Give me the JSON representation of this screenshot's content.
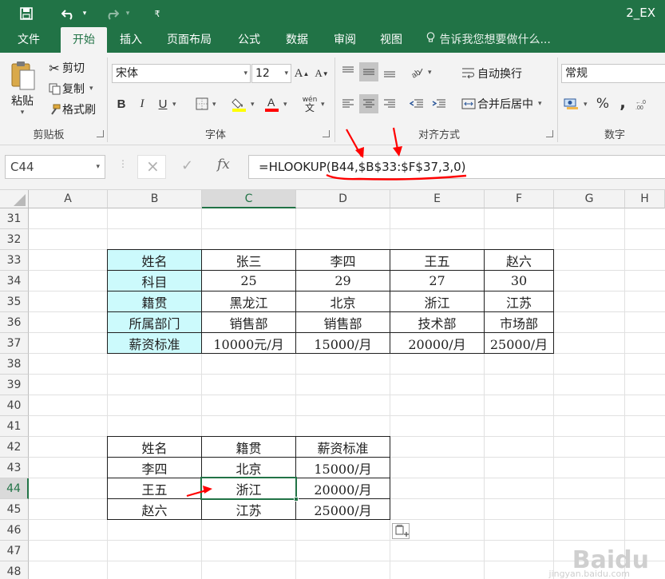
{
  "titlebar": {
    "doc_title": "2_EX",
    "save_icon": "save-icon",
    "undo_icon": "undo-icon",
    "redo_icon": "redo-icon",
    "customize_icon": "customize-qat-icon"
  },
  "tabs": {
    "file": "文件",
    "home": "开始",
    "insert": "插入",
    "layout": "页面布局",
    "formulas": "公式",
    "data": "数据",
    "review": "审阅",
    "view": "视图",
    "tell_me": "告诉我您想要做什么..."
  },
  "ribbon": {
    "clipboard": {
      "paste": "粘贴",
      "cut": "剪切",
      "copy": "复制",
      "format_painter": "格式刷",
      "label": "剪贴板"
    },
    "font": {
      "name": "宋体",
      "size": "12",
      "bold": "B",
      "italic": "I",
      "underline": "U",
      "phonetic": "wén",
      "label": "字体"
    },
    "alignment": {
      "wrap_text": "自动换行",
      "merge_center": "合并后居中",
      "label": "对齐方式"
    },
    "number": {
      "format": "常规",
      "percent": "%",
      "comma": ",",
      "label": "数字"
    }
  },
  "formula_bar": {
    "name_box": "C44",
    "cancel": "×",
    "enter": "✓",
    "fx": "fx",
    "formula": "=HLOOKUP(B44,$B$33:$F$37,3,0)"
  },
  "grid": {
    "columns": [
      "A",
      "B",
      "C",
      "D",
      "E",
      "F",
      "G",
      "H"
    ],
    "rows": [
      "31",
      "32",
      "33",
      "34",
      "35",
      "36",
      "37",
      "38",
      "39",
      "40",
      "41",
      "42",
      "43",
      "44",
      "45",
      "46",
      "47",
      "48"
    ],
    "active_column": "C",
    "active_row": "44",
    "table1": [
      [
        "姓名",
        "张三",
        "李四",
        "王五",
        "赵六"
      ],
      [
        "科目",
        "25",
        "29",
        "27",
        "30"
      ],
      [
        "籍贯",
        "黑龙江",
        "北京",
        "浙江",
        "江苏"
      ],
      [
        "所属部门",
        "销售部",
        "销售部",
        "技术部",
        "市场部"
      ],
      [
        "薪资标准",
        "10000元/月",
        "15000/月",
        "20000/月",
        "25000/月"
      ]
    ],
    "table2": [
      [
        "姓名",
        "籍贯",
        "薪资标准"
      ],
      [
        "李四",
        "北京",
        "15000/月"
      ],
      [
        "王五",
        "浙江",
        "20000/月"
      ],
      [
        "赵六",
        "江苏",
        "25000/月"
      ]
    ]
  },
  "watermark": {
    "brand": "Baidu",
    "url": "jingyan.baidu.com"
  },
  "colors": {
    "excel_green": "#217346",
    "header_fill": "#ccfafc",
    "annotation_red": "#ff0000"
  }
}
